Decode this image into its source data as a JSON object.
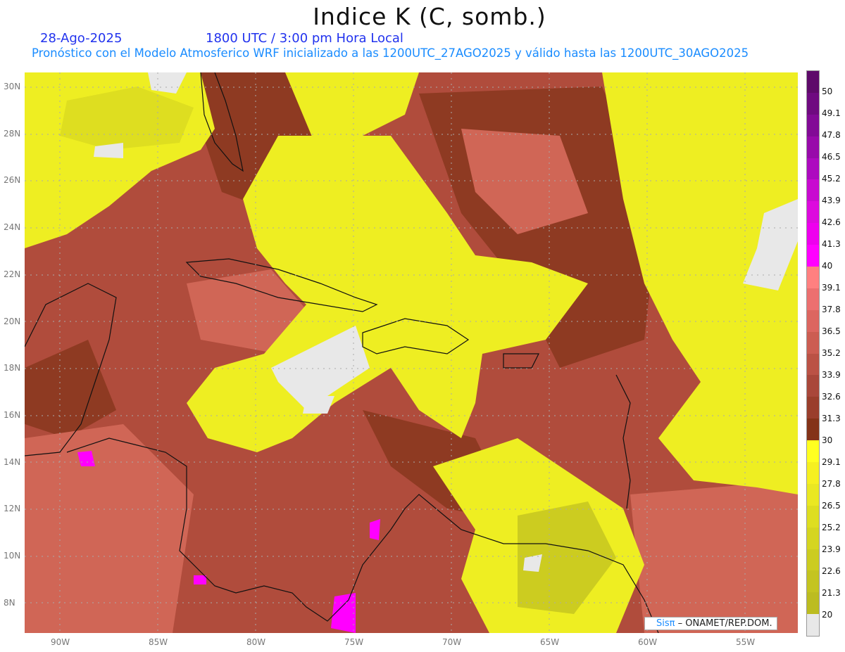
{
  "header": {
    "title": "Indice K (C, somb.)",
    "date": "28-Ago-2025",
    "time": "1800 UTC / 3:00 pm Hora Local",
    "subtitle": "Pronóstico con el Modelo Atmosferico WRF inicializado a las 1200UTC_27AGO2025 y válido hasta las  1200UTC_30AGO2025"
  },
  "colorbar": {
    "labels": [
      "50",
      "49.1",
      "47.8",
      "46.5",
      "45.2",
      "43.9",
      "42.6",
      "41.3",
      "40",
      "39.1",
      "37.8",
      "36.5",
      "35.2",
      "33.9",
      "32.6",
      "31.3",
      "30",
      "29.1",
      "27.8",
      "26.5",
      "25.2",
      "23.9",
      "22.6",
      "21.3",
      "20"
    ],
    "colors": [
      "#5e0a6a",
      "#6f0a80",
      "#820a96",
      "#980aaa",
      "#ad0abf",
      "#c80ad0",
      "#dd0ade",
      "#ee00ee",
      "#ff00ff",
      "#ff8080",
      "#ec7070",
      "#dc6660",
      "#cc5d52",
      "#bb5245",
      "#a9473a",
      "#9a3e2c",
      "#843318",
      "#ffff20",
      "#f6f020",
      "#eae822",
      "#dede20",
      "#d5d520",
      "#cccc20",
      "#c4c420",
      "#bcbc20",
      "#e8e8e8"
    ]
  },
  "axes": {
    "lat": [
      "30N",
      "28N",
      "26N",
      "24N",
      "22N",
      "20N",
      "18N",
      "16N",
      "14N",
      "12N",
      "10N",
      "8N"
    ],
    "lon": [
      "90W",
      "85W",
      "80W",
      "75W",
      "70W",
      "65W",
      "60W",
      "55W"
    ]
  },
  "credit": {
    "logo": "Sisπ",
    "text": "– ONAMET/REP.DOM."
  }
}
